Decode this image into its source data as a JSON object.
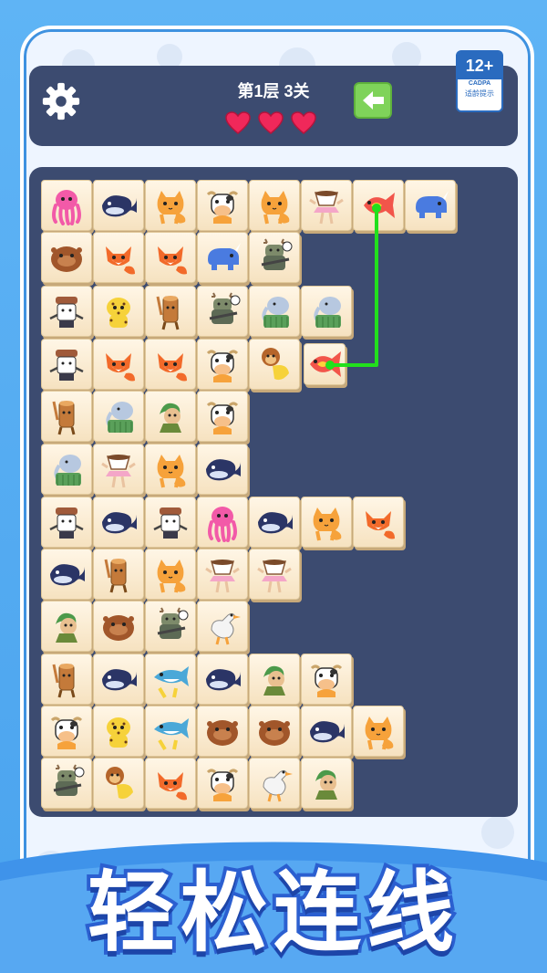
{
  "header": {
    "level_text": "第1层 3关",
    "hearts": 3,
    "back_icon": "arrow-left-icon",
    "settings_icon": "gear-icon"
  },
  "age_rating": {
    "top": "12+",
    "middle": "CADPA",
    "bottom": "适龄提示"
  },
  "board": {
    "rows": [
      [
        "octopus",
        "whale",
        "cat",
        "cow",
        "cat",
        "ballet-cup",
        "fish",
        "rhino"
      ],
      [
        "capybara",
        "fox",
        "fox",
        "rhino",
        "deer",
        "",
        "",
        ""
      ],
      [
        "chef",
        "leopard",
        "log",
        "deer",
        "elephant",
        "elephant",
        "",
        ""
      ],
      [
        "chef",
        "fox",
        "fox",
        "cow",
        "monkey",
        "fish",
        "",
        ""
      ],
      [
        "log",
        "elephant",
        "cactus",
        "cow",
        "",
        "",
        "",
        ""
      ],
      [
        "elephant",
        "ballet-cup",
        "cat",
        "whale",
        "",
        "",
        "",
        ""
      ],
      [
        "chef",
        "whale",
        "chef",
        "octopus",
        "whale",
        "cat",
        "fox",
        ""
      ],
      [
        "whale",
        "log",
        "cat",
        "ballet-cup",
        "ballet-cup",
        "",
        "",
        ""
      ],
      [
        "cactus",
        "capybara",
        "deer",
        "goose",
        "",
        "",
        "",
        ""
      ],
      [
        "log",
        "whale",
        "shark",
        "whale",
        "cactus",
        "cow",
        "",
        ""
      ],
      [
        "cow",
        "leopard",
        "shark",
        "capybara",
        "capybara",
        "whale",
        "cat",
        ""
      ],
      [
        "deer",
        "monkey",
        "fox",
        "cow",
        "goose",
        "cactus",
        "",
        ""
      ]
    ],
    "connected_pair": [
      "fish-r0c6",
      "fish-r3c5"
    ]
  },
  "banner": {
    "title": "轻松连线"
  },
  "colors": {
    "panel": "#3c4b70",
    "tile": "#fff6e6",
    "path": "#22e01c",
    "heart": "#f0285a",
    "banner_stroke": "#2b5fd0"
  }
}
